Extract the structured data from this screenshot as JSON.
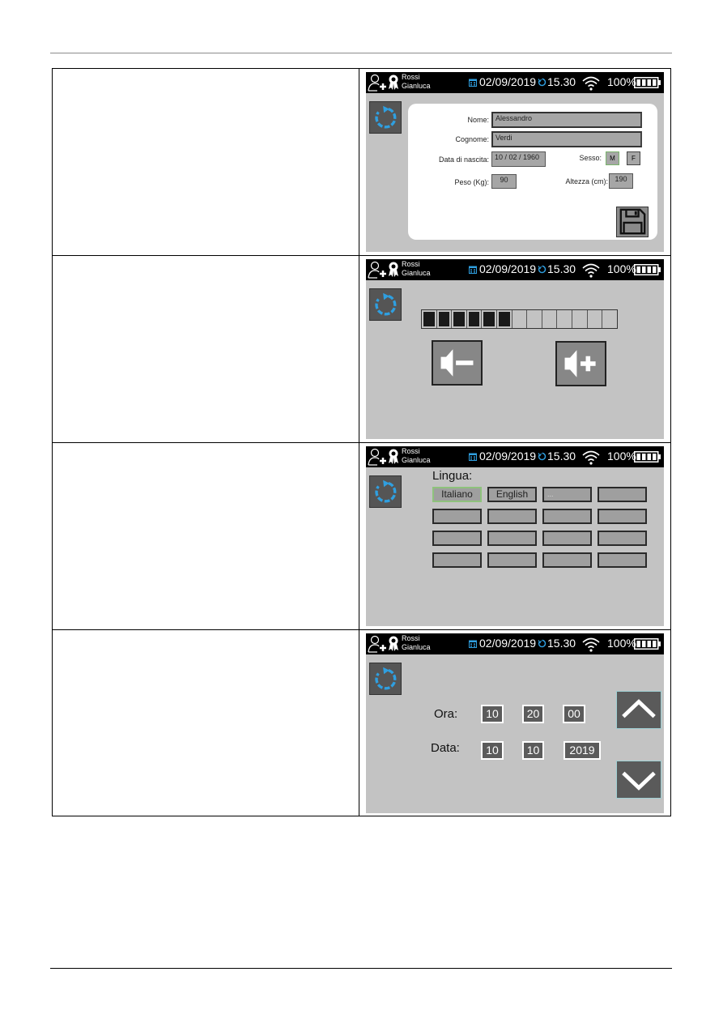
{
  "page": {
    "rows": 4
  },
  "statusbar": {
    "user_last": "Rossi",
    "user_first": "Gianluca",
    "date": "02/09/2019",
    "time": "15.30",
    "battery": "100%",
    "icons": [
      "user-add-icon",
      "award-badge-icon",
      "calendar-icon",
      "timer-icon",
      "wifi-icon",
      "battery-icon"
    ]
  },
  "screen_profile": {
    "nome_label": "Nome:",
    "nome_value": "Alessandro",
    "cognome_label": "Cognome:",
    "cognome_value": "Verdi",
    "nascita_label": "Data di nascita:",
    "nascita_value": "10 / 02 / 1960",
    "sesso_label": "Sesso:",
    "sesso_options": [
      "M",
      "F"
    ],
    "sesso_selected": "M",
    "peso_label": "Peso (Kg):",
    "peso_value": "90",
    "altezza_label": "Altezza (cm):",
    "altezza_value": "190"
  },
  "screen_volume": {
    "segments_total": 13,
    "segments_on": 6
  },
  "screen_language": {
    "title": "Lingua:",
    "options": [
      "Italiano",
      "English",
      "...",
      "",
      "",
      "",
      "",
      "",
      "",
      "",
      "",
      "",
      "",
      "",
      "",
      ""
    ],
    "selected": "Italiano"
  },
  "screen_datetime": {
    "ora_label": "Ora:",
    "ora_hh": "10",
    "ora_mm": "20",
    "ora_ss": "00",
    "data_label": "Data:",
    "data_dd": "10",
    "data_mm": "10",
    "data_yyyy": "2019"
  },
  "colors": {
    "accent_blue": "#2f9fe0",
    "screen_bg": "#c3c3c3",
    "selected_green": "#8ec27c"
  }
}
